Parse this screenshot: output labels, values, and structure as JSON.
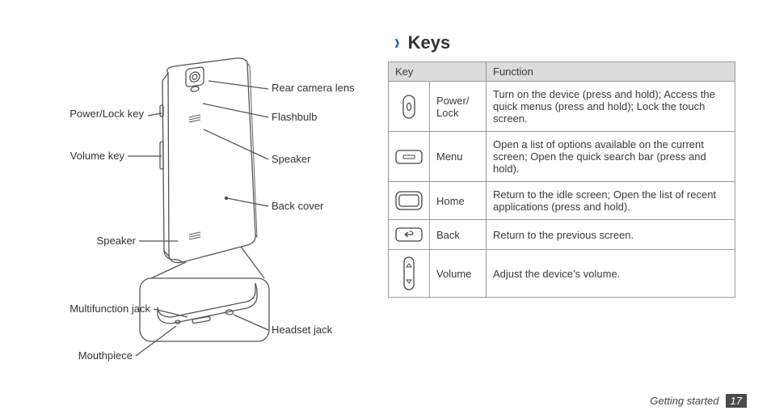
{
  "section": {
    "title": "Keys"
  },
  "table": {
    "headers": {
      "col1": "Key",
      "col2": "Function"
    },
    "rows": [
      {
        "name": "Power/\nLock",
        "func": "Turn on the device (press and hold); Access the quick menus (press and hold); Lock the touch screen."
      },
      {
        "name": "Menu",
        "func": "Open a list of options available on the current screen; Open the quick search bar (press and hold)."
      },
      {
        "name": "Home",
        "func": "Return to the idle screen; Open the list of recent applications (press and hold)."
      },
      {
        "name": "Back",
        "func": "Return to the previous screen."
      },
      {
        "name": "Volume",
        "func": "Adjust the device’s volume."
      }
    ]
  },
  "diagram": {
    "labels_left": {
      "power_lock": "Power/Lock key",
      "volume": "Volume key",
      "speaker": "Speaker",
      "multifunction": "Multifunction jack",
      "mouthpiece": "Mouthpiece"
    },
    "labels_right": {
      "camera": "Rear camera lens",
      "flash": "Flashbulb",
      "speaker": "Speaker",
      "back_cover": "Back cover",
      "headset": "Headset jack"
    }
  },
  "footer": {
    "section": "Getting started",
    "page": "17"
  }
}
